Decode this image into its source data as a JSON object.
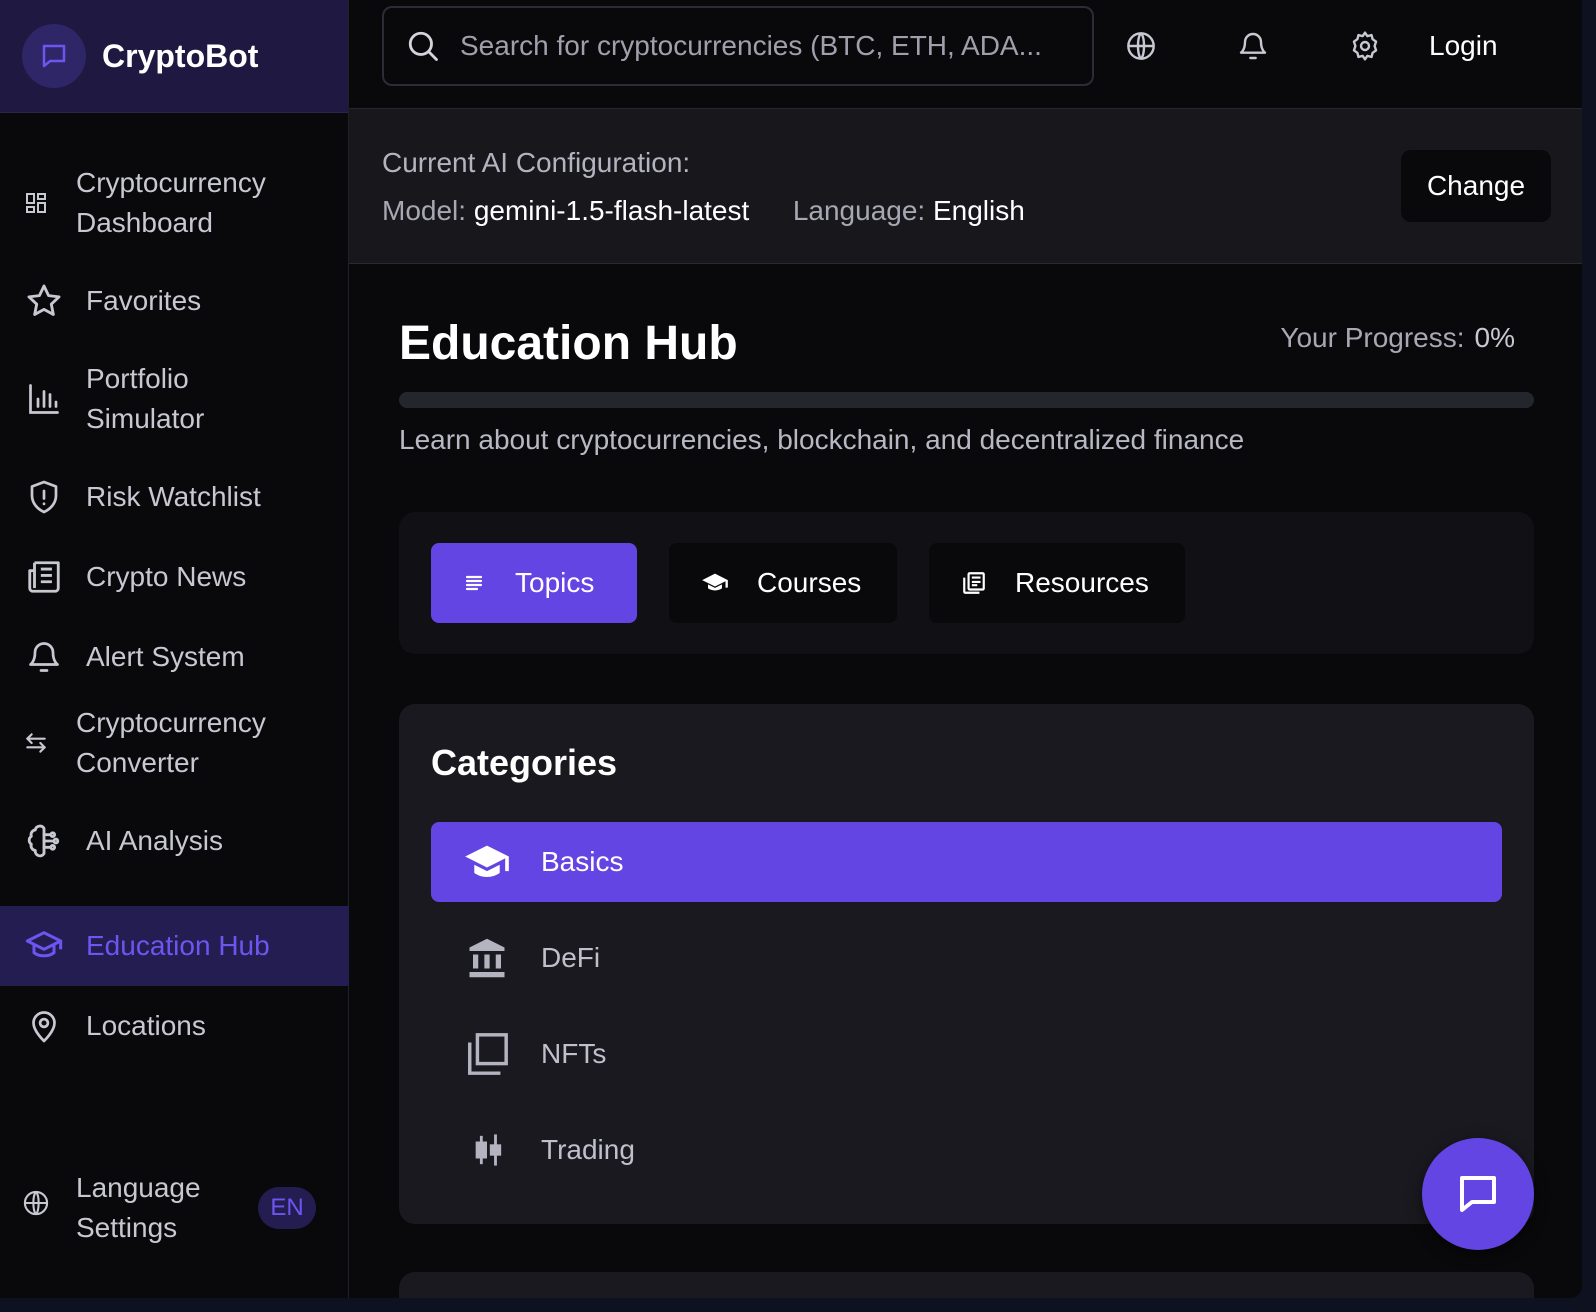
{
  "brand": {
    "name": "CryptoBot"
  },
  "sidebar": {
    "items": [
      {
        "label": "Cryptocurrency\nDashboard"
      },
      {
        "label": "Favorites"
      },
      {
        "label": "Portfolio\nSimulator"
      },
      {
        "label": "Risk Watchlist"
      },
      {
        "label": "Crypto News"
      },
      {
        "label": "Alert System"
      },
      {
        "label": "Cryptocurrency\nConverter"
      },
      {
        "label": "AI Analysis"
      },
      {
        "label": "Education Hub"
      },
      {
        "label": "Locations"
      }
    ],
    "language": {
      "label": "Language\nSettings",
      "code": "EN"
    }
  },
  "topbar": {
    "search_placeholder": "Search for cryptocurrencies (BTC, ETH, ADA...)",
    "login_label": "Login"
  },
  "config": {
    "title": "Current AI Configuration:",
    "model_label": "Model:",
    "model_value": "gemini-1.5-flash-latest",
    "language_label": "Language:",
    "language_value": "English",
    "change_label": "Change"
  },
  "main": {
    "title": "Education Hub",
    "progress_label": "Your Progress:",
    "progress_value": "0%",
    "progress_fraction": 0,
    "subtitle": "Learn about cryptocurrencies, blockchain, and decentralized finance",
    "tabs": [
      {
        "label": "Topics",
        "icon": "list-icon"
      },
      {
        "label": "Courses",
        "icon": "graduation-cap-icon"
      },
      {
        "label": "Resources",
        "icon": "book-icon"
      }
    ],
    "categories_title": "Categories",
    "categories": [
      {
        "label": "Basics",
        "icon": "graduation-cap-icon"
      },
      {
        "label": "DeFi",
        "icon": "bank-icon"
      },
      {
        "label": "NFTs",
        "icon": "images-icon"
      },
      {
        "label": "Trading",
        "icon": "candlestick-icon"
      }
    ]
  },
  "colors": {
    "accent": "#6345e4",
    "accent_text": "#6d55f0",
    "active_nav_bg": "#241d52",
    "brand_bg": "#1f1840",
    "background": "#09090b"
  }
}
